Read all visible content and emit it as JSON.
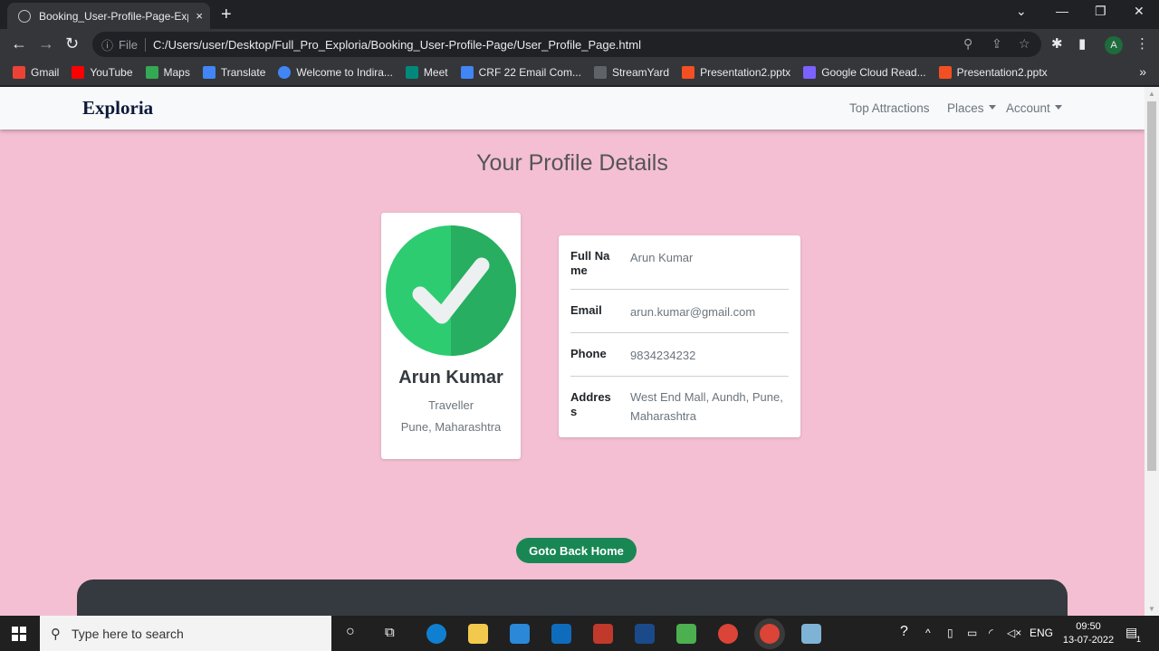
{
  "browser": {
    "tab_title": "Booking_User-Profile-Page-Exploria",
    "tab_close": "×",
    "new_tab": "+",
    "omnibox": {
      "file_label": "File",
      "url": "C:/Users/user/Desktop/Full_Pro_Exploria/Booking_User-Profile-Page/User_Profile_Page.html"
    },
    "profile_initial": "A",
    "bookmarks": [
      {
        "label": "Gmail",
        "color": "#ea4335"
      },
      {
        "label": "YouTube",
        "color": "#ff0000"
      },
      {
        "label": "Maps",
        "color": "#34a853"
      },
      {
        "label": "Translate",
        "color": "#4285f4"
      },
      {
        "label": "Welcome to Indira...",
        "color": "#4285f4"
      },
      {
        "label": "Meet",
        "color": "#00897b"
      },
      {
        "label": "CRF 22 Email Com...",
        "color": "#4285f4"
      },
      {
        "label": "StreamYard",
        "color": "#5f6368"
      },
      {
        "label": "Presentation2.pptx",
        "color": "#f25022"
      },
      {
        "label": "Google Cloud Read...",
        "color": "#7b61ff"
      },
      {
        "label": "Presentation2.pptx",
        "color": "#f25022"
      }
    ],
    "bookmarks_more": "»"
  },
  "site": {
    "brand": "Exploria",
    "nav": {
      "top_attractions": "Top Attractions",
      "places": "Places",
      "account": "Account"
    },
    "heading": "Your Profile Details",
    "profile": {
      "name": "Arun Kumar",
      "role": "Traveller",
      "location": "Pune, Maharashtra"
    },
    "details": {
      "full_name_label": "Full Name",
      "full_name": "Arun Kumar",
      "email_label": "Email",
      "email": "arun.kumar@gmail.com",
      "phone_label": "Phone",
      "phone": "9834234232",
      "address_label": "Address",
      "address": "West End Mall, Aundh, Pune, Maharashtra"
    },
    "home_button": "Goto Back Home",
    "colors": {
      "page_bg": "#f4bfd2",
      "accent_green": "#198754",
      "check_green": "#2ecc71"
    }
  },
  "taskbar": {
    "search_placeholder": "Type here to search",
    "language": "ENG",
    "time": "09:50",
    "date": "13-07-2022",
    "notification_count": "1"
  }
}
